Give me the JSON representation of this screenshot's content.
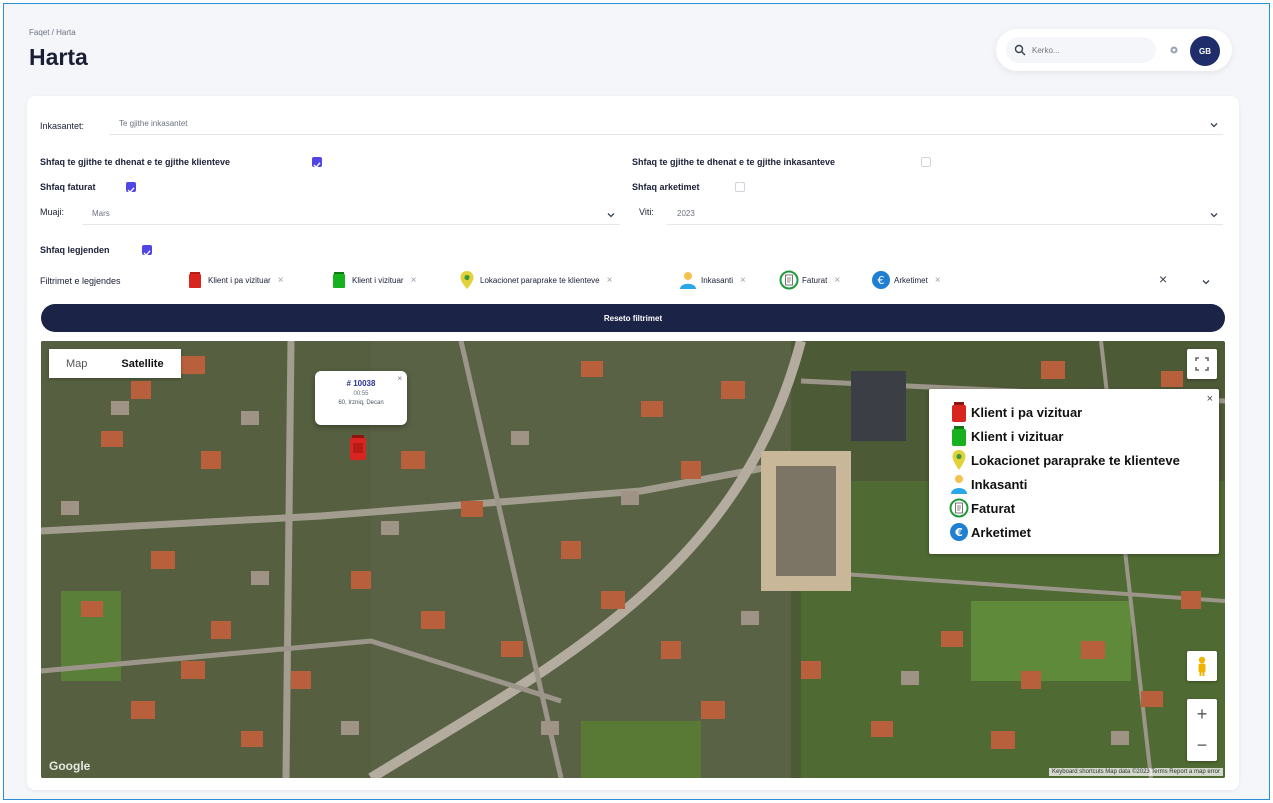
{
  "page": {
    "breadcrumb": "Faqet / Harta",
    "title": "Harta"
  },
  "header": {
    "search_placeholder": "Kerko...",
    "avatar_initials": "GB"
  },
  "filters": {
    "collectors_label": "Inkasantet:",
    "collectors_value": "Te gjithe inkasantet",
    "show_all_clients_label": "Shfaq te gjithe te dhenat e te gjithe klienteve",
    "show_all_clients_checked": true,
    "show_all_collectors_label": "Shfaq te gjithe te dhenat e te gjithe inkasanteve",
    "show_all_collectors_checked": false,
    "show_invoices_label": "Shfaq faturat",
    "show_invoices_checked": true,
    "show_receipts_label": "Shfaq arketimet",
    "show_receipts_checked": false,
    "month_label": "Muaji:",
    "month_value": "Mars",
    "year_label": "Viti:",
    "year_value": "2023",
    "show_legend_label": "Shfaq legjenden",
    "show_legend_checked": true,
    "legend_filters_label": "Filtrimet e legjendes",
    "chips": [
      {
        "label": "Klient i pa vizituar",
        "icon": "red-bin-icon"
      },
      {
        "label": "Klient i vizituar",
        "icon": "green-bin-icon"
      },
      {
        "label": "Lokacionet paraprake te klienteve",
        "icon": "location-pin-icon"
      },
      {
        "label": "Inkasanti",
        "icon": "collector-person-icon"
      },
      {
        "label": "Faturat",
        "icon": "invoice-icon"
      },
      {
        "label": "Arketimet",
        "icon": "euro-coin-icon"
      }
    ],
    "reset_label": "Reseto filtrimet"
  },
  "map": {
    "type_options": [
      "Map",
      "Satellite"
    ],
    "active_type": "Satellite",
    "info_window": {
      "id": "# 10038",
      "sub": "00:55",
      "address": "60, Irzniq, Decan"
    },
    "legend": {
      "items": [
        {
          "label": "Klient i pa vizituar",
          "icon": "red-bin-icon",
          "color": "#d8251f"
        },
        {
          "label": "Klient i vizituar",
          "icon": "green-bin-icon",
          "color": "#17b01f"
        },
        {
          "label": "Lokacionet paraprake te klienteve",
          "icon": "location-pin-icon",
          "color": "#e3d13a"
        },
        {
          "label": "Inkasanti",
          "icon": "collector-person-icon",
          "color": "#2aa7e8"
        },
        {
          "label": "Faturat",
          "icon": "invoice-icon",
          "color": "#1f9a3a"
        },
        {
          "label": "Arketimet",
          "icon": "euro-coin-icon",
          "color": "#1f7fd1"
        }
      ]
    },
    "google_label": "Google",
    "attribution": "Keyboard shortcuts   Map data ©2023   Terms   Report a map error"
  },
  "colors": {
    "primary_dark": "#1b2347",
    "checkbox": "#4f46e5",
    "frame_border": "#2b8fd8"
  }
}
